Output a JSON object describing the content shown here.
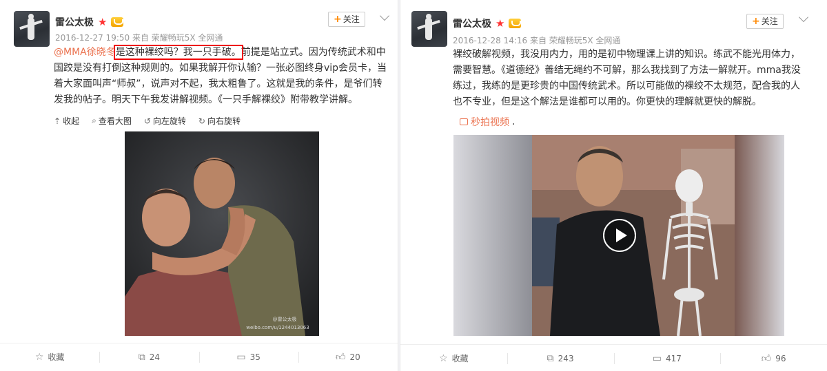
{
  "posts": [
    {
      "username": "雷公太极",
      "meta": "2016-12-27 19:50 来自 荣耀畅玩5X 全网通",
      "follow_label": "关注",
      "text": {
        "mention": "@MMA徐晓冬",
        "highlight": "是这种裸绞吗？我一只手破。",
        "body": "前提是站立式。因为传统武术和中国跤是没有打倒这种规则的。如果我解开你认输？一张必图终身vip会员卡，当着大家面叫声“师叔”，说声对不起，我太粗鲁了。这就是我的条件，是爷们转发我的帖子。明天下午我发讲解视频。《一只手解裸绞》附带教学讲解。"
      },
      "media_tools": [
        "收起",
        "查看大图",
        "向左旋转",
        "向右旋转"
      ],
      "watermark_line1": "@雷公太极",
      "watermark_line2": "weibo.com/u/1244013063",
      "actions": {
        "favorite": "收藏",
        "repost": "24",
        "comment": "35",
        "like": "20"
      }
    },
    {
      "username": "雷公太极",
      "meta": "2016-12-28 14:16 来自 荣耀畅玩5X 全网通",
      "follow_label": "关注",
      "text": {
        "body": "裸绞破解视频，我没用内力，用的是初中物理课上讲的知识。练武不能光用体力，需要智慧。《道德经》善结无绳约不可解，那么我找到了方法一解就开。mma我没练过，我练的是更珍贵的中国传统武术。所以可能做的裸绞不太规范，配合我的人也不专业，但是这个解法是谁都可以用的。你更快的理解就更快的解脱。"
      },
      "video_link": "秒拍视频",
      "actions": {
        "favorite": "收藏",
        "repost": "243",
        "comment": "417",
        "like": "96"
      }
    }
  ],
  "colors": {
    "link": "#eb7350",
    "highlight_box": "#e00000",
    "star": "#ff3333"
  },
  "icons": [
    "star-icon",
    "vip-crown-icon",
    "plus-icon",
    "chevron-down-icon",
    "collapse-icon",
    "zoom-icon",
    "rotate-left-icon",
    "rotate-right-icon",
    "camera-icon",
    "play-icon",
    "favorite-star-icon",
    "repost-icon",
    "comment-icon",
    "like-icon"
  ]
}
